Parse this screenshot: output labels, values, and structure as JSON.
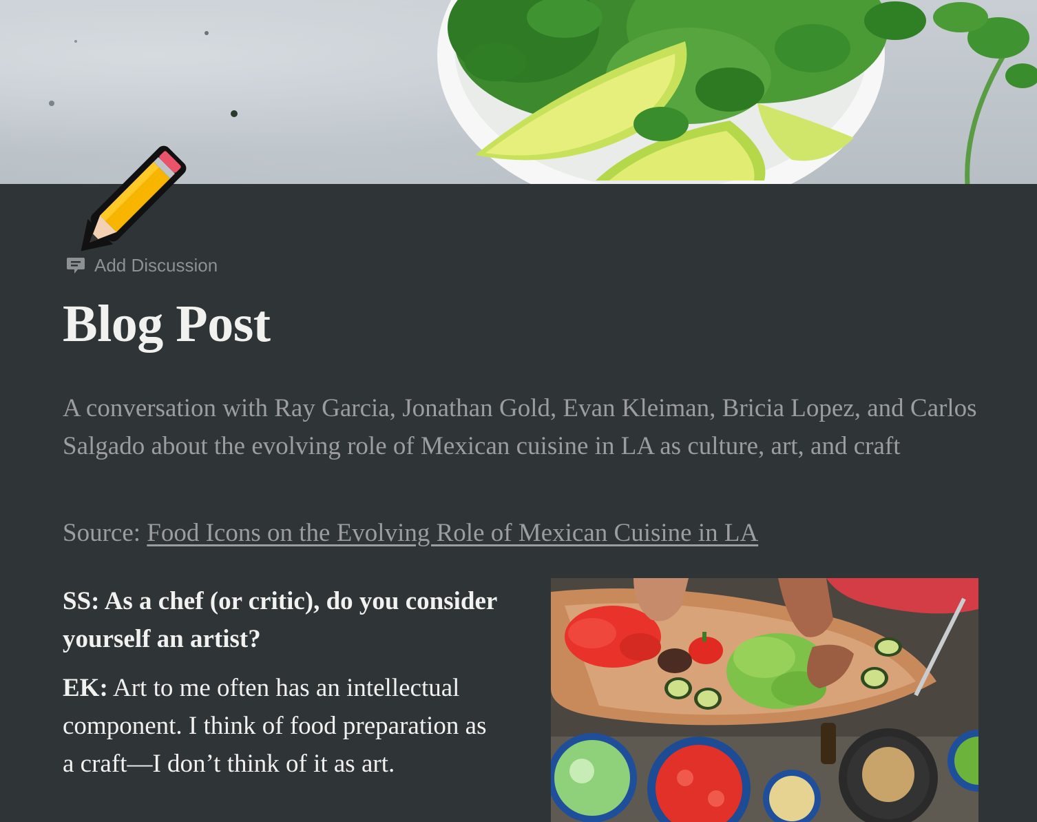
{
  "page": {
    "add_discussion_label": "Add Discussion",
    "title": "Blog Post",
    "subtitle": "A conversation with Ray Garcia, Jonathan Gold, Evan Kleiman, Bricia Lopez, and Carlos Salgado about the evolving role of Mexican cuisine in LA as culture, art, and craft",
    "source_label": "Source:",
    "source_link_text": "Food Icons on the Evolving Role of Mexican Cuisine in LA",
    "question": "SS: As a chef (or critic), do you consider yourself an artist?",
    "answer_speaker": "EK:",
    "answer_text": "Art to me often has an intellectual component. I think of food preparation as a craft—I don’t think of it as art."
  },
  "icons": {
    "page_icon": "pencil-icon",
    "discussion_icon": "comment-icon"
  },
  "colors": {
    "background": "#2f3437",
    "text_primary": "#f1f1ef",
    "text_muted": "#9b9d9f"
  }
}
